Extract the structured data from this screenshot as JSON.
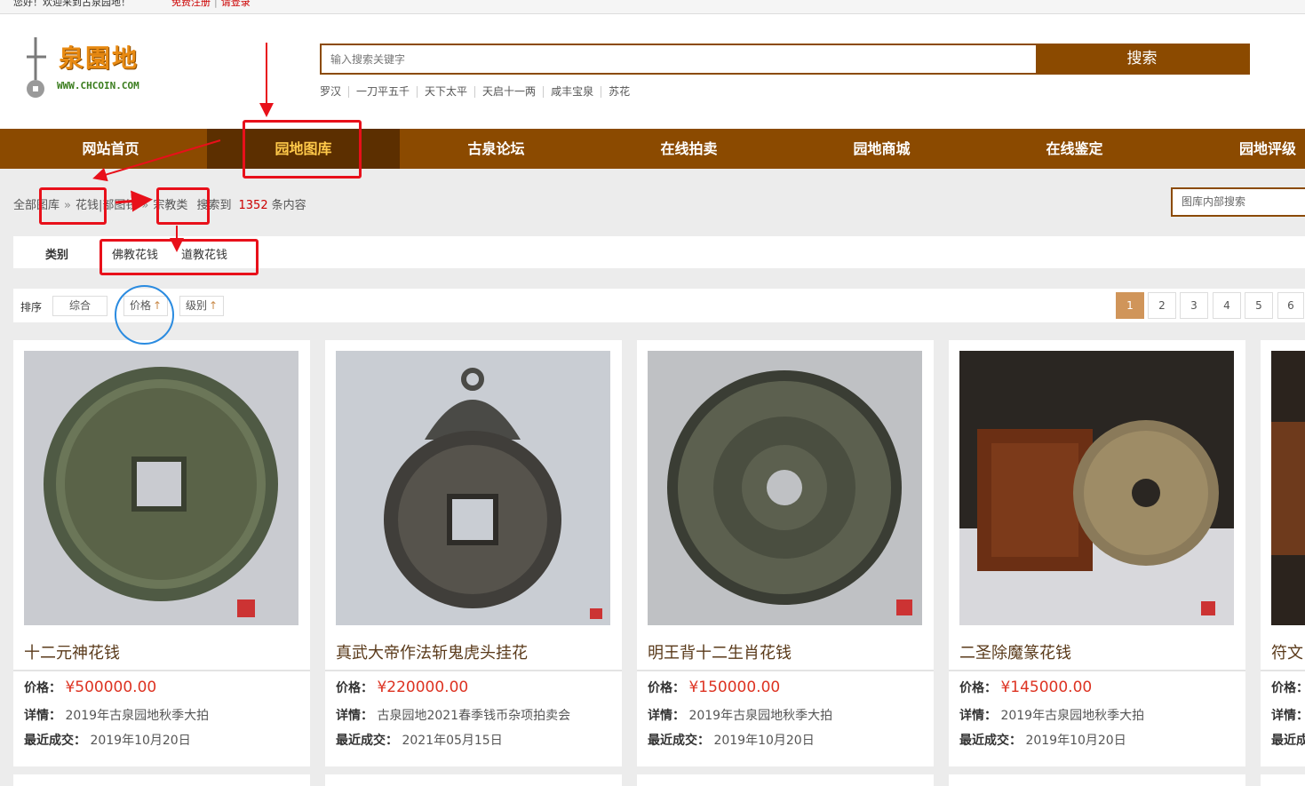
{
  "topbar": {
    "welcome": "您好！欢迎来到古泉园地！",
    "register": "免费注册",
    "login": "请登录"
  },
  "logo": {
    "brand": "泉園地",
    "url": "WWW.CHCOIN.COM"
  },
  "search": {
    "placeholder": "输入搜索关键字",
    "button": "搜索"
  },
  "hotwords": [
    "罗汉",
    "一刀平五千",
    "天下太平",
    "天启十一两",
    "咸丰宝泉",
    "苏花"
  ],
  "nav": [
    {
      "label": "网站首页",
      "active": false
    },
    {
      "label": "园地图库",
      "active": true
    },
    {
      "label": "古泉论坛",
      "active": false
    },
    {
      "label": "在线拍卖",
      "active": false
    },
    {
      "label": "园地商城",
      "active": false
    },
    {
      "label": "在线鉴定",
      "active": false
    },
    {
      "label": "园地评级",
      "active": false
    }
  ],
  "breadcrumb": {
    "root": "全部图库",
    "level1": "花钱|部图钱",
    "level2": "宗教类",
    "result_prefix": "搜索到",
    "count": "1352",
    "result_suffix": "条内容"
  },
  "inner_search": {
    "placeholder": "图库内部搜索"
  },
  "category": {
    "label": "类别",
    "options": [
      "佛教花钱",
      "道教花钱"
    ]
  },
  "sort": {
    "label": "排序",
    "options": [
      "综合",
      "价格",
      "级别"
    ]
  },
  "pager": [
    "1",
    "2",
    "3",
    "4",
    "5",
    "6"
  ],
  "cards": [
    {
      "title": "十二元神花钱",
      "price_label": "价格：",
      "price": "¥500000.00",
      "detail_label": "详情：",
      "detail": "2019年古泉园地秋季大拍",
      "deal_label": "最近成交：",
      "deal": "2019年10月20日"
    },
    {
      "title": "真武大帝作法斩鬼虎头挂花",
      "price_label": "价格：",
      "price": "¥220000.00",
      "detail_label": "详情：",
      "detail": "古泉园地2021春季钱币杂项拍卖会",
      "deal_label": "最近成交：",
      "deal": "2021年05月15日"
    },
    {
      "title": "明王背十二生肖花钱",
      "price_label": "价格：",
      "price": "¥150000.00",
      "detail_label": "详情：",
      "detail": "2019年古泉园地秋季大拍",
      "deal_label": "最近成交：",
      "deal": "2019年10月20日"
    },
    {
      "title": "二圣除魔篆花钱",
      "price_label": "价格：",
      "price": "¥145000.00",
      "detail_label": "详情：",
      "detail": "2019年古泉园地秋季大拍",
      "deal_label": "最近成交：",
      "deal": "2019年10月20日"
    },
    {
      "title": "符文",
      "price_label": "价格：",
      "price": "",
      "detail_label": "详情：",
      "detail": "",
      "deal_label": "最近成",
      "deal": ""
    }
  ],
  "colors": {
    "brand": "#8b4a00",
    "nav_active": "#5c2f00",
    "price": "#dd3322",
    "annotation_red": "#e8101a",
    "annotation_blue": "#2a8be0"
  }
}
